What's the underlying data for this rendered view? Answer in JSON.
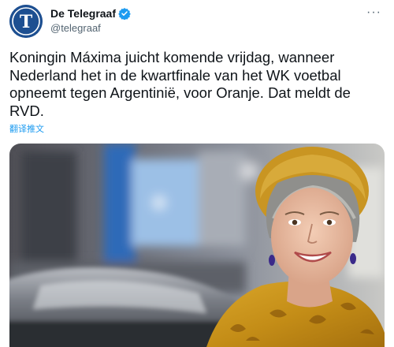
{
  "author": {
    "display_name": "De Telegraaf",
    "handle": "@telegraaf",
    "avatar_letter": "T",
    "verified": true
  },
  "tweet": {
    "text": "Koningin Máxima juicht komende vrijdag, wanneer Nederland het in de kwartfinale van het WK voetbal opneemt tegen Argentinië, voor Oranje. Dat meldt de RVD.",
    "translate_label": "翻译推文"
  },
  "icons": {
    "more": "more-horizontal-icon",
    "verified": "verified-badge-icon"
  },
  "colors": {
    "accent": "#1d9bf0",
    "avatar_bg": "#1d4f91",
    "text": "#0f1419",
    "secondary": "#536471"
  }
}
